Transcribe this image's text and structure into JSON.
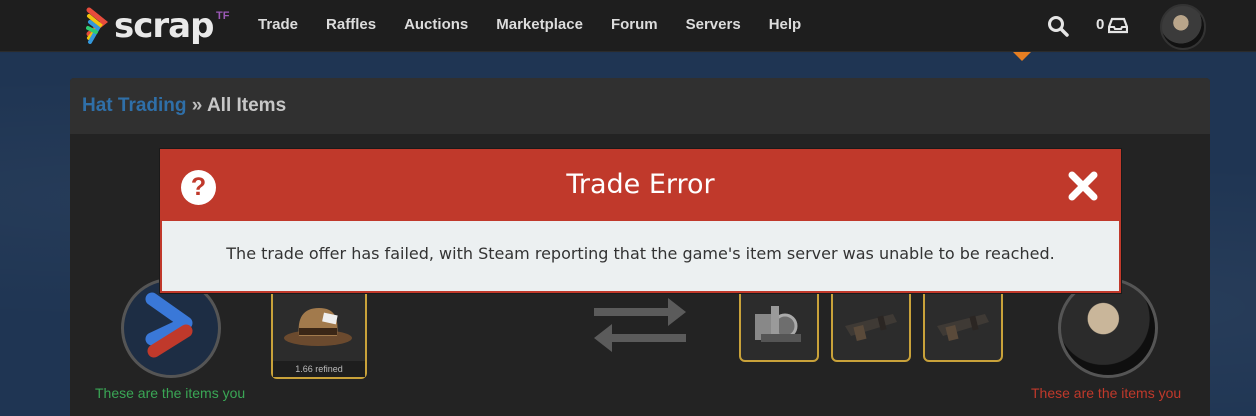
{
  "nav": {
    "logo": "scrap",
    "logo_suffix": "TF",
    "items": [
      "Trade",
      "Raffles",
      "Auctions",
      "Marketplace",
      "Forum",
      "Servers",
      "Help"
    ],
    "count": "0"
  },
  "breadcrumb": {
    "link": "Hat Trading",
    "separator": "»",
    "current": "All Items"
  },
  "modal": {
    "title": "Trade Error",
    "message": "The trade offer has failed, with Steam reporting that the game's item server was unable to be reached."
  },
  "trade": {
    "left_caption": "These are the items you",
    "right_caption": "These are the items you",
    "left_item_price": "1.66 refined"
  },
  "colors": {
    "accent": "#c0392b",
    "link": "#2f6fa8",
    "slot_border": "#c9a23a",
    "left_caption": "#3aa655",
    "right_caption": "#c0392b"
  }
}
